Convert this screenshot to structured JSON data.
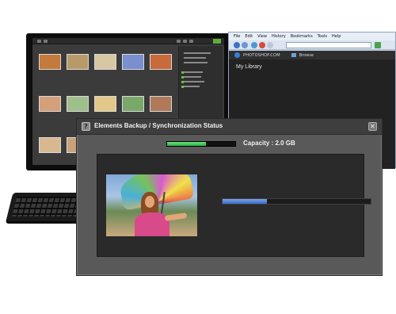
{
  "organizer": {
    "thumbnails": [
      {
        "color": "#c47a3a"
      },
      {
        "color": "#b89a6a"
      },
      {
        "color": "#d7c7a2"
      },
      {
        "color": "#7a8fd0"
      },
      {
        "color": "#c86a3a"
      },
      {
        "color": "#d4a07a"
      },
      {
        "color": "#9fbf8a"
      },
      {
        "color": "#e2c98a"
      },
      {
        "color": "#7aa86a"
      },
      {
        "color": "#b07a5a"
      },
      {
        "color": "#d8b890"
      },
      {
        "color": "#c9a27a"
      }
    ]
  },
  "browser": {
    "menu": [
      "File",
      "Edit",
      "View",
      "History",
      "Bookmarks",
      "Tools",
      "Help"
    ],
    "brand": "PHOTOSHOP.COM",
    "nav_browse": "Browse",
    "library_title": "My Library"
  },
  "dialog": {
    "title": "Elements Backup / Synchronization Status",
    "app_icon_glyph": "?",
    "close_glyph": "✕",
    "capacity_label": "Capacity : 2.0 GB",
    "capacity_fraction": 0.57,
    "progress_fraction": 0.3,
    "colors": {
      "capacity_fill": "#2fb04a",
      "progress_fill": "#3c6cc8",
      "dialog_bg": "#595959",
      "inner_bg": "#2a2a2a"
    }
  }
}
